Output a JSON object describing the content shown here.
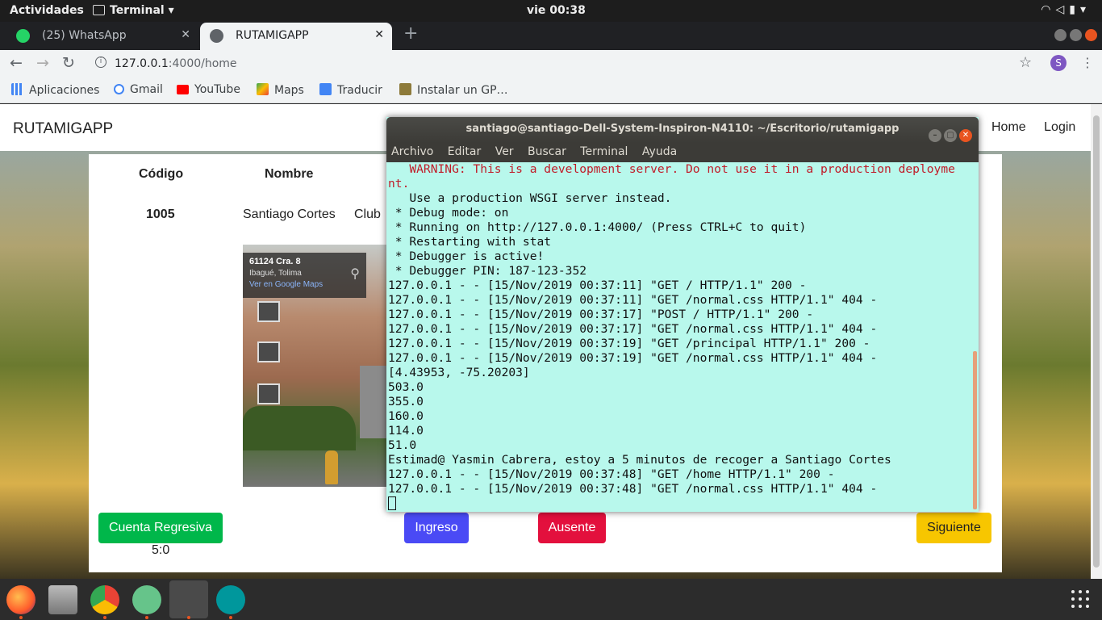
{
  "topbar": {
    "activities": "Actividades",
    "app_name": "Terminal",
    "clock": "vie 00:38",
    "tray_icons": [
      "wifi-icon",
      "volume-icon",
      "battery-icon",
      "power-menu-icon"
    ]
  },
  "browser": {
    "tabs": [
      {
        "label": "(25) WhatsApp",
        "favicon": "whatsapp-icon",
        "badge": "25",
        "active": false
      },
      {
        "label": "RUTAMIGAPP",
        "favicon": "globe-icon",
        "active": true
      }
    ],
    "url_host": "127.0.0.1",
    "url_path": ":4000/home",
    "profile_initial": "S",
    "bookmarks": [
      {
        "label": "Aplicaciones",
        "icon": "apps-grid-icon"
      },
      {
        "label": "Gmail",
        "icon": "google-icon"
      },
      {
        "label": "YouTube",
        "icon": "youtube-icon"
      },
      {
        "label": "Maps",
        "icon": "maps-icon"
      },
      {
        "label": "Traducir",
        "icon": "translate-icon"
      },
      {
        "label": "Instalar un GP…",
        "icon": "bookmark-page-icon"
      }
    ]
  },
  "page": {
    "brand": "RUTAMIGAPP",
    "nav": [
      "Home",
      "Login"
    ],
    "table": {
      "headers": [
        "Código",
        "Nombre"
      ],
      "row": {
        "codigo": "1005",
        "nombre": "Santiago Cortes",
        "extra": "Club"
      }
    },
    "map": {
      "address": "61124 Cra. 8",
      "city": "Ibagué, Tolima",
      "link": "Ver en Google Maps"
    },
    "buttons": {
      "countdown": "Cuenta Regresiva",
      "ingreso": "Ingreso",
      "ausente": "Ausente",
      "siguiente": "Siguiente"
    },
    "timer": "5:0",
    "colors": {
      "countdown": "#00b74a",
      "ingreso": "#4a4af5",
      "ausente": "#e3103d",
      "siguiente": "#f7c600"
    }
  },
  "terminal": {
    "title": "santiago@santiago-Dell-System-Inspiron-N4110: ~/Escritorio/rutamigapp",
    "menu": [
      "Archivo",
      "Editar",
      "Ver",
      "Buscar",
      "Terminal",
      "Ayuda"
    ],
    "warning_lines": [
      "   WARNING: This is a development server. Do not use it in a production deployme",
      "nt."
    ],
    "lines": [
      "   Use a production WSGI server instead.",
      " * Debug mode: on",
      " * Running on http://127.0.0.1:4000/ (Press CTRL+C to quit)",
      " * Restarting with stat",
      " * Debugger is active!",
      " * Debugger PIN: 187-123-352",
      "127.0.0.1 - - [15/Nov/2019 00:37:11] \"GET / HTTP/1.1\" 200 -",
      "127.0.0.1 - - [15/Nov/2019 00:37:11] \"GET /normal.css HTTP/1.1\" 404 -",
      "127.0.0.1 - - [15/Nov/2019 00:37:17] \"POST / HTTP/1.1\" 200 -",
      "127.0.0.1 - - [15/Nov/2019 00:37:17] \"GET /normal.css HTTP/1.1\" 404 -",
      "127.0.0.1 - - [15/Nov/2019 00:37:19] \"GET /principal HTTP/1.1\" 200 -",
      "127.0.0.1 - - [15/Nov/2019 00:37:19] \"GET /normal.css HTTP/1.1\" 404 -",
      "[4.43953, -75.20203]",
      "503.0",
      "355.0",
      "160.0",
      "114.0",
      "51.0",
      "Estimad@ Yasmin Cabrera, estoy a 5 minutos de recoger a Santiago Cortes",
      "127.0.0.1 - - [15/Nov/2019 00:37:48] \"GET /home HTTP/1.1\" 200 -",
      "127.0.0.1 - - [15/Nov/2019 00:37:48] \"GET /normal.css HTTP/1.1\" 404 -"
    ]
  },
  "dock": {
    "apps": [
      "firefox-icon",
      "files-icon",
      "chrome-icon",
      "atom-icon",
      "terminal-icon",
      "arduino-icon"
    ],
    "show_apps": "show-applications-icon"
  }
}
